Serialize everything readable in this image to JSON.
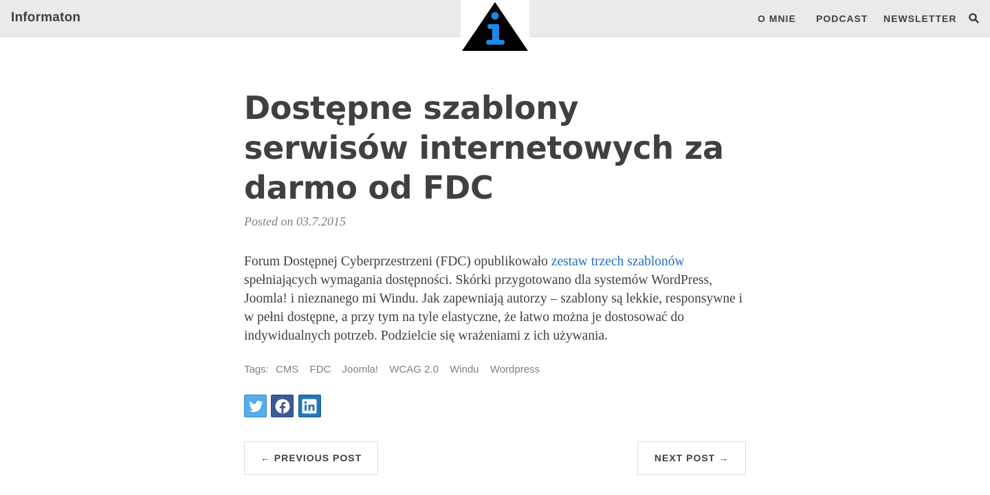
{
  "header": {
    "brand": "Informaton",
    "nav": [
      "O MNIE",
      "PODCAST",
      "NEWSLETTER"
    ]
  },
  "post": {
    "title": "Dostępne szablony serwisów internetowych za darmo od FDC",
    "meta": "Posted on 03.7.2015",
    "body_before": "Forum Dostępnej Cyberprzestrzeni (FDC) opublikowało ",
    "body_link": "zestaw trzech szablonów",
    "body_after": " spełniających wymagania dostępności. Skórki przygotowano dla systemów WordPress, Joomla! i nieznanego mi Windu. Jak zapewniają autorzy – szablony są lekkie, responsywne i w pełni dostępne, a przy tym na tyle elastyczne, że łatwo można je dostosować do indywidualnych potrzeb. Podzielcie się wrażeniami z ich używania."
  },
  "tags": {
    "label": "Tags:",
    "items": [
      "CMS",
      "FDC",
      "Joomla!",
      "WCAG 2.0",
      "Windu",
      "Wordpress"
    ]
  },
  "share": {
    "icons": [
      "twitter-icon",
      "facebook-icon",
      "linkedin-icon"
    ],
    "colors": {
      "twitter": "#55acee",
      "facebook": "#3b5998",
      "linkedin": "#1f79b7"
    }
  },
  "pager": {
    "prev": "← PREVIOUS POST",
    "next": "NEXT POST →"
  },
  "colors": {
    "link": "#1e6fc2",
    "header_bg": "#eaeaea",
    "logo_blue": "#1e88e5"
  }
}
